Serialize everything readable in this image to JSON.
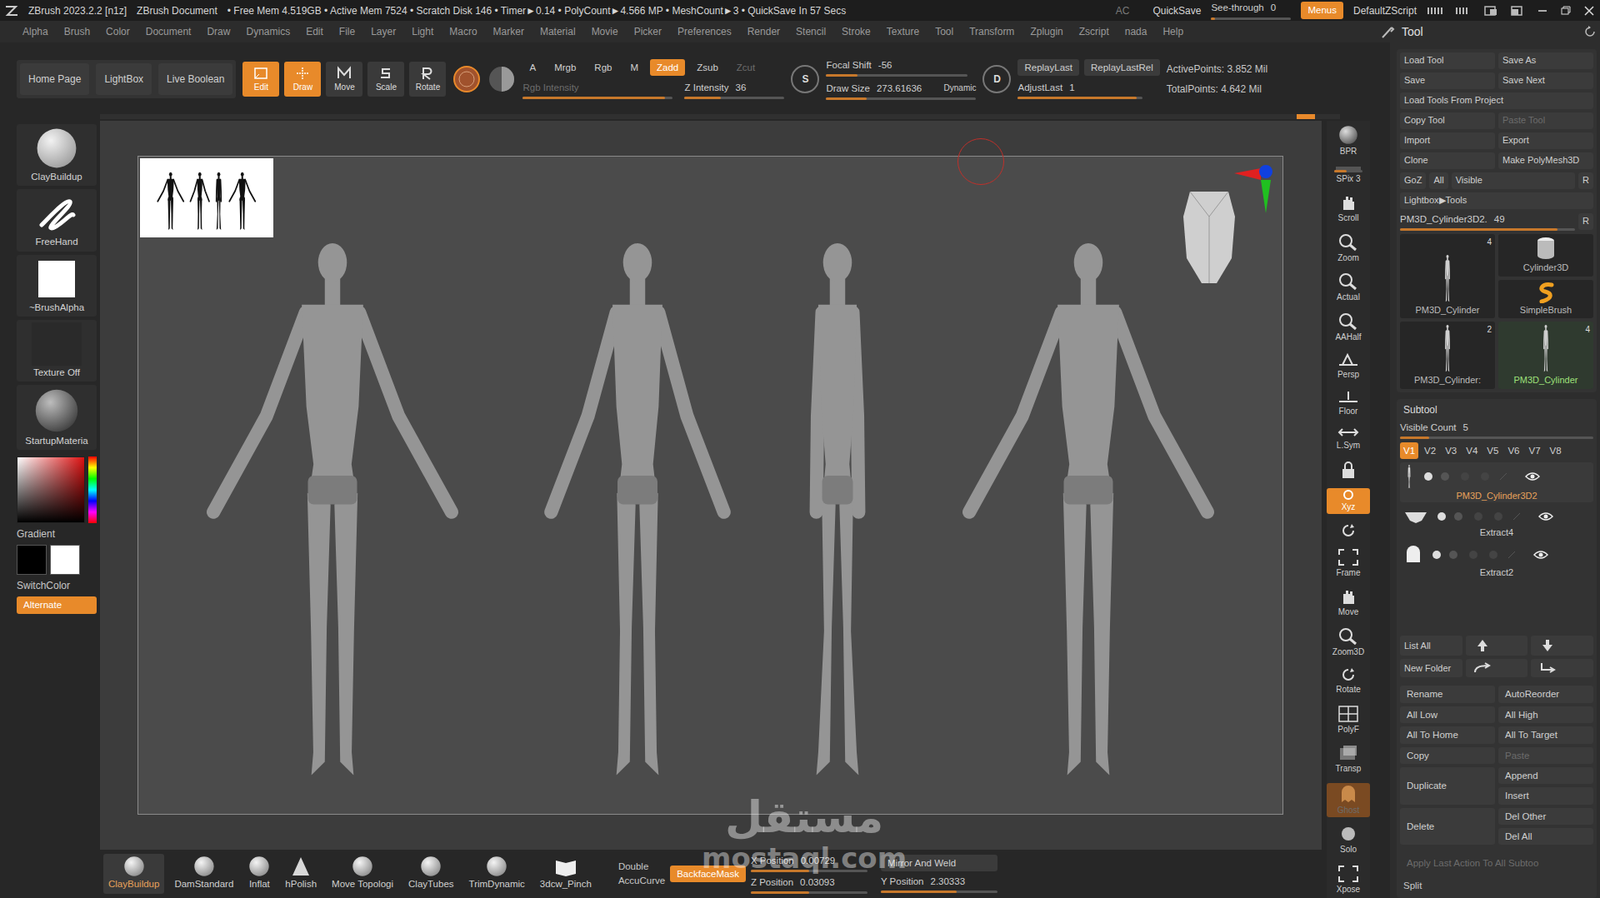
{
  "titlebar": {
    "app": "ZBrush 2023.2.2 [n1z]",
    "document": "ZBrush Document",
    "stats": "• Free Mem 4.519GB • Active Mem 7524 • Scratch Disk 146 • Timer►0.14 • PolyCount►4.566 MP • MeshCount►3 • QuickSave In 57 Secs",
    "ac": "AC",
    "quicksave": "QuickSave",
    "see_through": {
      "label": "See-through",
      "value": "0",
      "level": 0.05
    },
    "menus": {
      "label": "Menus",
      "on": true
    },
    "script": "DefaultZScript"
  },
  "menubar": [
    "Alpha",
    "Brush",
    "Color",
    "Document",
    "Draw",
    "Dynamics",
    "Edit",
    "File",
    "Layer",
    "Light",
    "Macro",
    "Marker",
    "Material",
    "Movie",
    "Picker",
    "Preferences",
    "Render",
    "Stencil",
    "Stroke",
    "Texture",
    "Tool",
    "Transform",
    "Zplugin",
    "Zscript",
    "nada",
    "Help"
  ],
  "top_shelf": {
    "nav": [
      {
        "label": "Home Page"
      },
      {
        "label": "LightBox"
      },
      {
        "label": "Live Boolean"
      }
    ],
    "modes": [
      {
        "label": "Edit",
        "selected": true,
        "kind": "edit"
      },
      {
        "label": "Draw",
        "selected": true,
        "kind": "draw"
      },
      {
        "label": "Move",
        "selected": false,
        "kind": "move"
      },
      {
        "label": "Scale",
        "selected": false,
        "kind": "scale"
      },
      {
        "label": "Rotate",
        "selected": false,
        "kind": "rotate"
      }
    ],
    "channels": [
      {
        "label": "A",
        "selected": false,
        "disabled": false
      },
      {
        "label": "Mrgb",
        "selected": false,
        "disabled": false
      },
      {
        "label": "Rgb",
        "selected": false,
        "disabled": false
      },
      {
        "label": "M",
        "selected": false,
        "disabled": false
      },
      {
        "label": "Zadd",
        "selected": true,
        "disabled": false
      },
      {
        "label": "Zsub",
        "selected": false,
        "disabled": false
      },
      {
        "label": "Zcut",
        "selected": false,
        "disabled": true
      }
    ],
    "rgb_intensity": {
      "label": "Rgb Intensity",
      "level": 0.95,
      "disabled": true
    },
    "z_intensity": {
      "label": "Z Intensity",
      "value": "36",
      "level": 0.36
    },
    "s_icon": "S",
    "d_icon": "D",
    "focal_shift": {
      "label": "Focal Shift",
      "value": "-56",
      "level": 0.22
    },
    "draw_size": {
      "label": "Draw Size",
      "value": "273.61636",
      "level": 0.27,
      "dynamic": "Dynamic"
    },
    "replay": [
      {
        "label": "ReplayLast"
      },
      {
        "label": "ReplayLastRel"
      }
    ],
    "adjust_last": {
      "label": "AdjustLast",
      "value": "1",
      "level": 0.95
    },
    "points": [
      "ActivePoints: 3.852 Mil",
      "TotalPoints: 4.642 Mil"
    ]
  },
  "left_shelf": {
    "items": [
      {
        "label": "ClayBuildup",
        "kind": "brush"
      },
      {
        "label": "FreeHand",
        "kind": "stroke"
      },
      {
        "label": "~BrushAlpha",
        "kind": "alpha"
      },
      {
        "label": "Texture Off",
        "kind": "texture"
      },
      {
        "label": "StartupMateria",
        "kind": "material"
      }
    ],
    "gradient": "Gradient",
    "swatches": [
      {
        "color": "#000000"
      },
      {
        "color": "#ffffff"
      }
    ],
    "switch_color": "SwitchColor",
    "alternate": {
      "label": "Alternate",
      "on": true
    }
  },
  "right_shelf": [
    {
      "label": "BPR",
      "kind": "bpr",
      "on": false,
      "disabled": false
    },
    {
      "label": "SPix 3",
      "kind": "slider",
      "level": 0.45,
      "on": false,
      "disabled": false
    },
    {
      "label": "Scroll",
      "kind": "hand",
      "on": false,
      "disabled": false
    },
    {
      "label": "Zoom",
      "kind": "zoom",
      "on": false,
      "disabled": false
    },
    {
      "label": "Actual",
      "kind": "zoom",
      "on": false,
      "disabled": false
    },
    {
      "label": "AAHalf",
      "kind": "zoom",
      "on": false,
      "disabled": false
    },
    {
      "label": "Persp",
      "kind": "persp",
      "on": false,
      "disabled": false
    },
    {
      "label": "Floor",
      "kind": "floor",
      "on": false,
      "disabled": false
    },
    {
      "label": "L.Sym",
      "kind": "sym",
      "on": false,
      "disabled": false
    },
    {
      "kind": "lock",
      "on": false,
      "disabled": false
    },
    {
      "label": "Xyz",
      "kind": "xyz",
      "on": true,
      "disabled": false
    },
    {
      "kind": "spin",
      "on": false,
      "disabled": false
    },
    {
      "label": "Frame",
      "kind": "frame",
      "on": false,
      "disabled": false
    },
    {
      "label": "Move",
      "kind": "hand",
      "on": false,
      "disabled": false
    },
    {
      "label": "Zoom3D",
      "kind": "zoom",
      "on": false,
      "disabled": false
    },
    {
      "label": "Rotate",
      "kind": "spin",
      "on": false,
      "disabled": false
    },
    {
      "label": "PolyF",
      "kind": "grid",
      "on": false,
      "disabled": false
    },
    {
      "label": "Transp",
      "kind": "transp",
      "on": false,
      "disabled": false
    },
    {
      "label": "Ghost",
      "kind": "ghost",
      "on": true,
      "disabled": true
    },
    {
      "label": "Solo",
      "kind": "solo",
      "on": false,
      "disabled": false
    },
    {
      "label": "Xpose",
      "kind": "frame",
      "on": false,
      "disabled": false
    }
  ],
  "bottom_shelf": {
    "brushes": [
      {
        "label": "ClayBuildup",
        "selected": true,
        "kind": "sphere"
      },
      {
        "label": "DamStandard",
        "selected": false,
        "kind": "sphere"
      },
      {
        "label": "Inflat",
        "selected": false,
        "kind": "sphere"
      },
      {
        "label": "hPolish",
        "selected": false,
        "kind": "cone"
      },
      {
        "label": "Move Topologi",
        "selected": false,
        "kind": "sphere"
      },
      {
        "label": "ClayTubes",
        "selected": false,
        "kind": "sphere"
      },
      {
        "label": "TrimDynamic",
        "selected": false,
        "kind": "sphere"
      },
      {
        "label": "3dcw_Pinch",
        "selected": false,
        "kind": "book"
      }
    ],
    "double": "Double",
    "accucurve": "AccuCurve",
    "backface": {
      "label": "BackfaceMask",
      "on": true
    },
    "x_position": {
      "label": "X Position",
      "value": "0.00729",
      "level": 0.5
    },
    "z_position": {
      "label": "Z Position",
      "value": "0.03093",
      "level": 0.5
    },
    "mirror": "Mirror And Weld",
    "y_position": {
      "label": "Y Position",
      "value": "2.30333",
      "level": 0.65
    }
  },
  "tool_panel": {
    "title": "Tool",
    "file_buttons": [
      [
        {
          "label": "Load Tool",
          "disabled": false
        },
        {
          "label": "Save As",
          "disabled": false
        }
      ],
      [
        {
          "label": "Save",
          "disabled": false
        },
        {
          "label": "Save Next",
          "disabled": false
        }
      ],
      [
        {
          "label": "Load Tools From Project",
          "disabled": false
        }
      ],
      [
        {
          "label": "Copy Tool",
          "disabled": false
        },
        {
          "label": "Paste Tool",
          "disabled": true
        }
      ],
      [
        {
          "label": "Import",
          "disabled": false
        },
        {
          "label": "Export",
          "disabled": false
        }
      ],
      [
        {
          "label": "Clone",
          "disabled": false
        },
        {
          "label": "Make PolyMesh3D",
          "disabled": false
        }
      ],
      [
        {
          "label": "GoZ",
          "disabled": false
        },
        {
          "label": "All",
          "disabled": false
        },
        {
          "label": "Visible",
          "disabled": false
        },
        {
          "label": "R",
          "disabled": false
        }
      ],
      [
        {
          "label": "Lightbox▶Tools",
          "disabled": false
        }
      ]
    ],
    "current": {
      "label": "PM3D_Cylinder3D2.",
      "value": "49",
      "level": 0.9,
      "r": "R"
    },
    "thumbs": [
      {
        "label": "PM3D_Cylinder",
        "count": "4",
        "selected": false,
        "kind": "figure"
      },
      {
        "label": "Cylinder3D",
        "selected": false,
        "kind": "cylinder"
      },
      {
        "label": "SimpleBrush",
        "selected": false,
        "kind": "brush"
      },
      {
        "label": "PM3D_Cylinder:",
        "count": "2",
        "selected": false,
        "kind": "figure"
      },
      {
        "label": "PM3D_Cylinder",
        "count": "4",
        "selected": true,
        "kind": "figure"
      }
    ],
    "subtool": {
      "title": "Subtool",
      "visible_count": {
        "label": "Visible Count",
        "value": "5",
        "level": 0.15
      },
      "versions": [
        {
          "label": "V1",
          "selected": true
        },
        {
          "label": "V2",
          "selected": false
        },
        {
          "label": "V3",
          "selected": false
        },
        {
          "label": "V4",
          "selected": false
        },
        {
          "label": "V5",
          "selected": false
        },
        {
          "label": "V6",
          "selected": false
        },
        {
          "label": "V7",
          "selected": false
        },
        {
          "label": "V8",
          "selected": false
        }
      ],
      "items": [
        {
          "name": "PM3D_Cylinder3D2",
          "selected": true,
          "visible": true,
          "kind": "figure"
        },
        {
          "name": "Extract4",
          "selected": false,
          "visible": true,
          "kind": "brief"
        },
        {
          "name": "Extract2",
          "selected": false,
          "visible": true,
          "kind": "cap"
        }
      ],
      "list_all": "List All",
      "new_folder": "New Folder",
      "actions": [
        {
          "label": "Rename",
          "disabled": false
        },
        {
          "label": "AutoReorder",
          "disabled": false
        },
        {
          "label": "All Low",
          "disabled": false
        },
        {
          "label": "All High",
          "disabled": false
        },
        {
          "label": "All To Home",
          "disabled": false
        },
        {
          "label": "All To Target",
          "disabled": false
        },
        {
          "label": "Copy",
          "disabled": false
        },
        {
          "label": "Paste",
          "disabled": true
        }
      ],
      "stacks": [
        {
          "main": "Duplicate",
          "side": [
            "Append",
            "Insert"
          ]
        },
        {
          "main": "Delete",
          "side": [
            "Del Other",
            "Del All"
          ]
        }
      ],
      "apply_all": {
        "label": "Apply Last Action To All Subtoo",
        "disabled": true
      },
      "split": "Split"
    }
  },
  "watermark": {
    "arabic": "مستقل",
    "latin": "mostaql.com"
  }
}
